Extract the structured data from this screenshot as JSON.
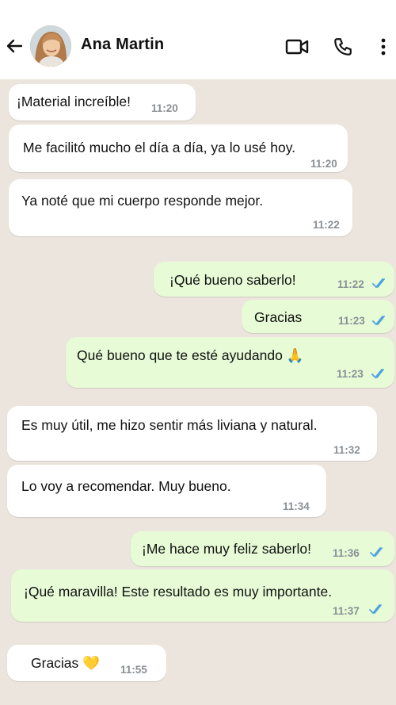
{
  "header": {
    "contact_name": "Ana Martin",
    "back_icon": "arrow-left-icon",
    "video_icon": "video-camera-icon",
    "call_icon": "phone-icon",
    "menu_icon": "more-vertical-icon"
  },
  "colors": {
    "incoming_bubble": "#ffffff",
    "outgoing_bubble": "#e6fbd6",
    "read_ticks": "#4fa3e0",
    "chat_background": "#ece5dd"
  },
  "messages": [
    {
      "direction": "in",
      "text": "¡Material increíble!",
      "time": "11:20"
    },
    {
      "direction": "in",
      "text": "Me facilitó mucho el día a día, ya lo usé hoy.",
      "time": "11:20"
    },
    {
      "direction": "in",
      "text": "Ya noté que mi cuerpo responde mejor.",
      "time": "11:22"
    },
    {
      "direction": "out",
      "text": "¡Qué bueno saberlo!",
      "time": "11:22",
      "status": "read"
    },
    {
      "direction": "out",
      "text": "Gracias",
      "time": "11:23",
      "status": "read"
    },
    {
      "direction": "out",
      "text": "Qué bueno que te esté ayudando 🙏",
      "time": "11:23",
      "status": "read"
    },
    {
      "direction": "in",
      "text": "Es muy útil, me hizo sentir más liviana y natural.",
      "time": "11:32"
    },
    {
      "direction": "in",
      "text": "Lo voy a recomendar. Muy bueno.",
      "time": "11:34"
    },
    {
      "direction": "out",
      "text": "¡Me hace muy feliz saberlo!",
      "time": "11:36",
      "status": "read"
    },
    {
      "direction": "out",
      "text": "¡Qué maravilla! Este resultado es muy importante.",
      "time": "11:37",
      "status": "read"
    },
    {
      "direction": "in",
      "text": "Gracias 💛",
      "time": "11:55"
    }
  ]
}
